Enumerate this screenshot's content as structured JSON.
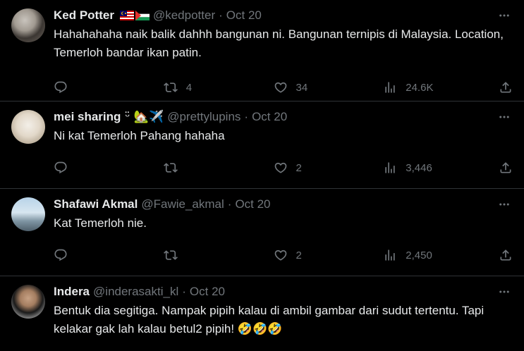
{
  "tweets": [
    {
      "name": "Ked Potter",
      "name_suffix": "🇲🇾🇵🇸",
      "handle": "@kedpotter",
      "sep": "·",
      "time": "Oct 20",
      "text": "Hahahahaha naik balik dahhh bangunan ni. Bangunan ternipis di Malaysia. Location, Temerloh bandar ikan patin.",
      "replies": "",
      "retweets": "4",
      "likes": "34",
      "views": "24.6K"
    },
    {
      "name": "mei sharing",
      "name_suffix": "ᵕ̈ 🏡✈️",
      "handle": "@prettylupins",
      "sep": "·",
      "time": "Oct 20",
      "text": "Ni kat Temerloh Pahang hahaha",
      "replies": "",
      "retweets": "",
      "likes": "2",
      "views": "3,446"
    },
    {
      "name": "Shafawi Akmal",
      "name_suffix": "",
      "handle": "@Fawie_akmal",
      "sep": "·",
      "time": "Oct 20",
      "text": "Kat Temerloh nie.",
      "replies": "",
      "retweets": "",
      "likes": "2",
      "views": "2,450"
    },
    {
      "name": "Indera",
      "name_suffix": "",
      "handle": "@inderasakti_kl",
      "sep": "·",
      "time": "Oct 20",
      "text": "Bentuk dia segitiga. Nampak pipih kalau di ambil gambar dari sudut tertentu. Tapi kelakar gak lah kalau betul2 pipih! 🤣🤣🤣"
    }
  ],
  "icons": {
    "reply": "reply-icon",
    "retweet": "retweet-icon",
    "like": "heart-icon",
    "views": "views-icon",
    "share": "share-icon",
    "more": "more-icon"
  },
  "colors": {
    "background": "#000000",
    "text": "#e7e9ea",
    "muted": "#71767b",
    "divider": "#2f3336"
  }
}
